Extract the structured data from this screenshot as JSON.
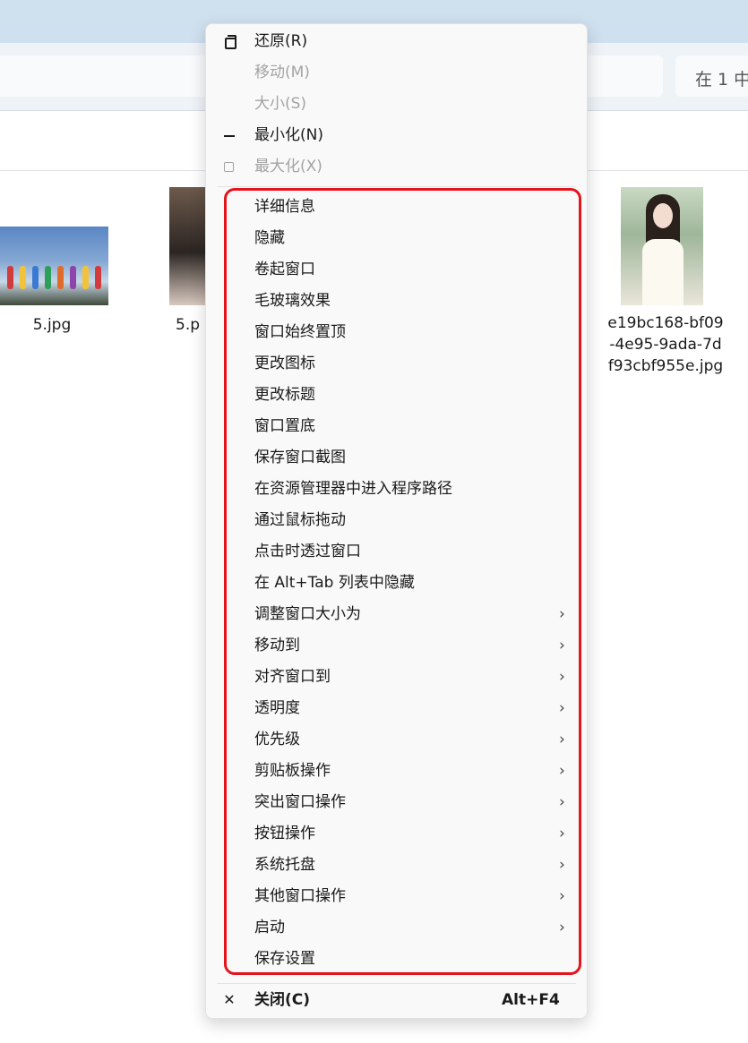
{
  "explorer": {
    "search_placeholder": "在 1 中",
    "files": [
      {
        "name": "5.jpg"
      },
      {
        "name": "5.p"
      },
      {
        "name": "e19bc168-bf09-4e95-9ada-7df93cbf955e.jpg",
        "lines": [
          "e19bc168-bf09",
          "-4e95-9ada-7d",
          "f93cbf955e.jpg"
        ]
      }
    ]
  },
  "menu": {
    "system_items": [
      {
        "label": "还原(R)",
        "icon": "restore-icon",
        "enabled": true
      },
      {
        "label": "移动(M)",
        "icon": "",
        "enabled": false
      },
      {
        "label": "大小(S)",
        "icon": "",
        "enabled": false
      },
      {
        "label": "最小化(N)",
        "icon": "minimize-icon",
        "enabled": true
      },
      {
        "label": "最大化(X)",
        "icon": "maximize-icon",
        "enabled": false
      }
    ],
    "extra_items": [
      {
        "label": "详细信息",
        "submenu": false
      },
      {
        "label": "隐藏",
        "submenu": false
      },
      {
        "label": "卷起窗口",
        "submenu": false
      },
      {
        "label": "毛玻璃效果",
        "submenu": false
      },
      {
        "label": "窗口始终置顶",
        "submenu": false
      },
      {
        "label": "更改图标",
        "submenu": false
      },
      {
        "label": "更改标题",
        "submenu": false
      },
      {
        "label": "窗口置底",
        "submenu": false
      },
      {
        "label": "保存窗口截图",
        "submenu": false
      },
      {
        "label": "在资源管理器中进入程序路径",
        "submenu": false
      },
      {
        "label": "通过鼠标拖动",
        "submenu": false
      },
      {
        "label": "点击时透过窗口",
        "submenu": false
      },
      {
        "label": "在 Alt+Tab 列表中隐藏",
        "submenu": false
      },
      {
        "label": "调整窗口大小为",
        "submenu": true
      },
      {
        "label": "移动到",
        "submenu": true
      },
      {
        "label": "对齐窗口到",
        "submenu": true
      },
      {
        "label": "透明度",
        "submenu": true
      },
      {
        "label": "优先级",
        "submenu": true
      },
      {
        "label": "剪贴板操作",
        "submenu": true
      },
      {
        "label": "突出窗口操作",
        "submenu": true
      },
      {
        "label": "按钮操作",
        "submenu": true
      },
      {
        "label": "系统托盘",
        "submenu": true
      },
      {
        "label": "其他窗口操作",
        "submenu": true
      },
      {
        "label": "启动",
        "submenu": true
      },
      {
        "label": "保存设置",
        "submenu": false
      }
    ],
    "close": {
      "label": "关闭(C)",
      "accelerator": "Alt+F4"
    },
    "chevron_glyph": "›",
    "close_glyph": "✕"
  },
  "colors": {
    "highlight_border": "#e3141b",
    "menu_background": "#f9f9f9",
    "disabled_text": "#a3a3a3",
    "titlebar": "#cfe0ef"
  }
}
